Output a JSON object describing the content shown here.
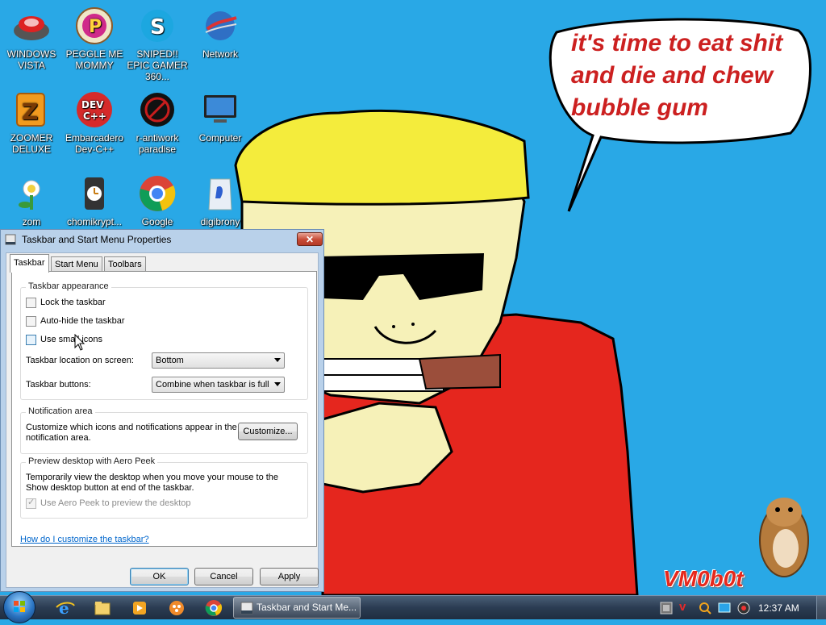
{
  "desktop": {
    "icons": [
      {
        "label": "WINDOWS VISTA"
      },
      {
        "label": "PEGGLE ME MOMMY"
      },
      {
        "label": "SNIPED!! EPIC GAMER 360..."
      },
      {
        "label": "Network"
      },
      {
        "label": "ZOOMER DELUXE"
      },
      {
        "label": "Embarcadero Dev-C++"
      },
      {
        "label": "r-antiwork paradise"
      },
      {
        "label": "Computer"
      },
      {
        "label": "zom"
      },
      {
        "label": "chomikrypt..."
      },
      {
        "label": "Google"
      },
      {
        "label": "digibrony"
      }
    ],
    "speech_lines": [
      "it's time to eat shit",
      "and die and chew",
      "bubble gum"
    ],
    "signature": "VM0b0t",
    "dev_icon_text": "DEV C++"
  },
  "dialog": {
    "title": "Taskbar and Start Menu Properties",
    "close_label": "✕",
    "tabs": [
      {
        "label": "Taskbar",
        "active": true
      },
      {
        "label": "Start Menu",
        "active": false
      },
      {
        "label": "Toolbars",
        "active": false
      }
    ],
    "appearance": {
      "title": "Taskbar appearance",
      "lock_label": "Lock the taskbar",
      "lock_checked": false,
      "autohide_label": "Auto-hide the taskbar",
      "autohide_checked": false,
      "small_icons_label": "Use small icons",
      "small_icons_checked": false,
      "location_label": "Taskbar location on screen:",
      "location_value": "Bottom",
      "buttons_label": "Taskbar buttons:",
      "buttons_value": "Combine when taskbar is full"
    },
    "notification": {
      "title": "Notification area",
      "text_line1": "Customize which icons and notifications appear in the",
      "text_line2": "notification area.",
      "customize_label": "Customize..."
    },
    "aero": {
      "title": "Preview desktop with Aero Peek",
      "text_line1": "Temporarily view the desktop when you move your mouse to the",
      "text_line2": "Show desktop button at end of the taskbar.",
      "peek_label": "Use Aero Peek to preview the desktop",
      "peek_checked": true,
      "peek_disabled": true
    },
    "help_link": "How do I customize the taskbar?",
    "ok_label": "OK",
    "cancel_label": "Cancel",
    "apply_label": "Apply"
  },
  "taskbar": {
    "pinned": [
      "internet-explorer-icon",
      "windows-explorer-icon",
      "media-player-icon",
      "paint-app-icon",
      "chrome-icon"
    ],
    "active_task_label": "Taskbar and Start Me...",
    "clock": "12:37 AM",
    "tray_v_label": "v"
  },
  "colors": {
    "desktop_bg": "#29a8e6",
    "speech_text": "#cc2020",
    "shirt_red": "#e5261e",
    "hat_yellow": "#f4ec3c",
    "skin": "#f6f1b8"
  }
}
